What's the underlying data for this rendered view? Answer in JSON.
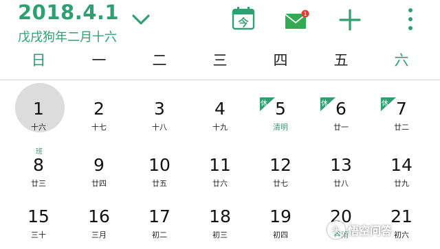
{
  "header": {
    "date": "2018.4.1",
    "lunar": "戊戌狗年二月十六",
    "icons": {
      "dropdown": "chevron-down-icon",
      "today": "calendar-today-icon",
      "today_label": "今",
      "mail": "mail-icon",
      "mail_badge": "1",
      "add": "plus-icon",
      "more": "more-vert-icon"
    }
  },
  "colors": {
    "accent": "#2f9f72",
    "selected": "#dcdcdc",
    "badge": "#e03c31"
  },
  "weekdays": [
    "日",
    "一",
    "二",
    "三",
    "四",
    "五",
    "六"
  ],
  "weeks": [
    [
      {
        "day": "1",
        "lunar": "十六",
        "selected": true
      },
      {
        "day": "2",
        "lunar": "十七"
      },
      {
        "day": "3",
        "lunar": "十八"
      },
      {
        "day": "4",
        "lunar": "十九"
      },
      {
        "day": "5",
        "lunar": "清明",
        "term": true,
        "holiday": "休"
      },
      {
        "day": "6",
        "lunar": "廿一",
        "holiday": "休"
      },
      {
        "day": "7",
        "lunar": "廿二",
        "holiday": "休"
      }
    ],
    [
      {
        "day": "8",
        "lunar": "廿三",
        "work": "班"
      },
      {
        "day": "9",
        "lunar": "廿四"
      },
      {
        "day": "10",
        "lunar": "廿五"
      },
      {
        "day": "11",
        "lunar": "廿六"
      },
      {
        "day": "12",
        "lunar": "廿七"
      },
      {
        "day": "13",
        "lunar": "廿八"
      },
      {
        "day": "14",
        "lunar": "廿九"
      }
    ],
    [
      {
        "day": "15",
        "lunar": "三十"
      },
      {
        "day": "16",
        "lunar": "三月"
      },
      {
        "day": "17",
        "lunar": "初二"
      },
      {
        "day": "18",
        "lunar": "初三"
      },
      {
        "day": "19",
        "lunar": "初四"
      },
      {
        "day": "20",
        "lunar": "谷雨",
        "term": true
      },
      {
        "day": "21",
        "lunar": "初六"
      }
    ]
  ],
  "watermark": {
    "text": "悟空问答",
    "logo": "头"
  }
}
